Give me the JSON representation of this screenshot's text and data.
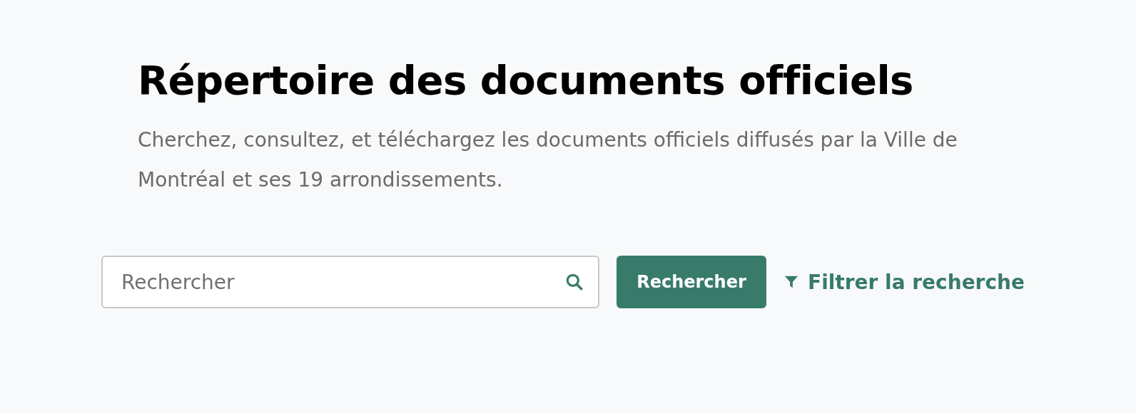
{
  "title": "Répertoire des documents officiels",
  "description": "Cherchez, consultez, et téléchargez les documents officiels diffusés par la Ville de Montréal et ses 19 arrondissements.",
  "search": {
    "placeholder": "Rechercher",
    "button": "Rechercher"
  },
  "filter_link": "Filtrer la recherche"
}
